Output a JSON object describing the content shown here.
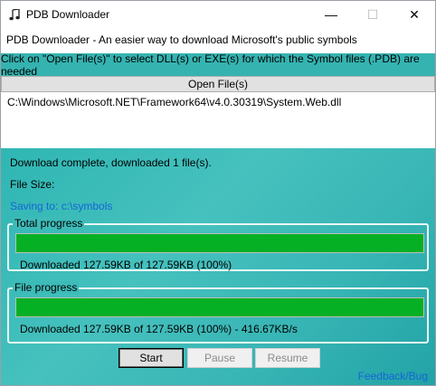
{
  "window": {
    "title": "PDB Downloader",
    "icon": "music-note-icon",
    "controls": {
      "minimize": "—",
      "maximize": "☐",
      "close": "✕"
    }
  },
  "header": {
    "subtitle": "PDB Downloader - An easier way to download Microsoft's public symbols",
    "instruction": "Click on \"Open File(s)\" to select DLL(s) or EXE(s) for which the Symbol files (.PDB) are needed",
    "accent_color": "#35b3b0"
  },
  "open_button_label": "Open File(s)",
  "files": [
    "C:\\Windows\\Microsoft.NET\\Framework64\\v4.0.30319\\System.Web.dll"
  ],
  "status": {
    "message": "Download complete, downloaded 1 file(s).",
    "file_size": "File Size:",
    "saving_to": "Saving to: c:\\symbols"
  },
  "total_progress": {
    "title": "Total progress",
    "percent": 100,
    "text": "Downloaded 127.59KB of 127.59KB (100%)"
  },
  "file_progress": {
    "title": "File progress",
    "percent": 100,
    "text": "Downloaded 127.59KB of 127.59KB (100%) - 416.67KB/s"
  },
  "buttons": {
    "start": "Start",
    "pause": "Pause",
    "resume": "Resume"
  },
  "feedback_link": "Feedback/Bug",
  "colors": {
    "progress_fill": "#06b025",
    "link": "#1565d8"
  }
}
